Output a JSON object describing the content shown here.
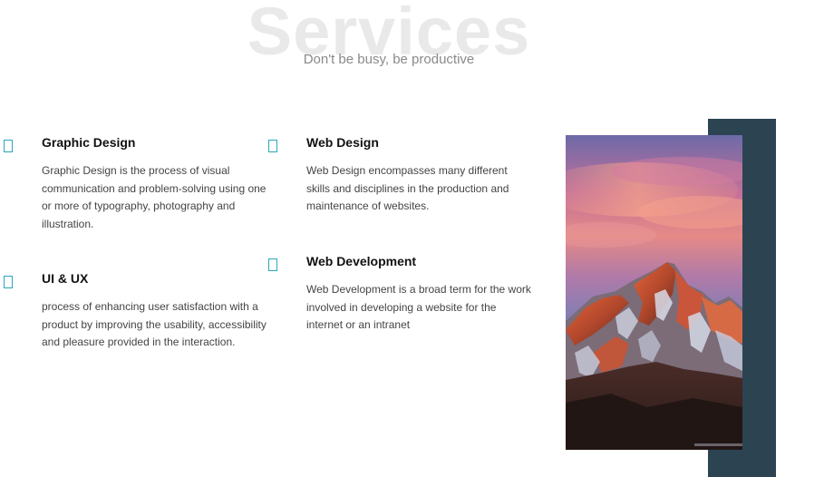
{
  "header": {
    "bg_title": "Services",
    "subtitle": "Don't be busy, be productive"
  },
  "services": [
    {
      "title": "Graphic Design",
      "description": "Graphic Design is the process of visual communication and problem-solving using one or more of typography, photography and illustration.",
      "icon": "square-outline-icon"
    },
    {
      "title": "Web Design",
      "description": "Web Design encompasses many different skills and disciplines in the production and maintenance of websites.",
      "icon": "square-outline-icon"
    },
    {
      "title": "UI & UX",
      "description": "process of enhancing user satisfaction with a product by improving the usability, accessibility and pleasure provided in the interaction.",
      "icon": "square-outline-icon"
    },
    {
      "title": "Web Development",
      "description": "Web Development is a broad term for the work involved in developing a website for the internet or an intranet",
      "icon": "square-outline-icon"
    }
  ],
  "colors": {
    "accent_icon": "#2aa8b8",
    "panel": "#2c4352",
    "bg_title": "#e9e9ea",
    "subtitle": "#8a8a8a"
  },
  "image": {
    "subject": "mountain peak at sunset"
  }
}
